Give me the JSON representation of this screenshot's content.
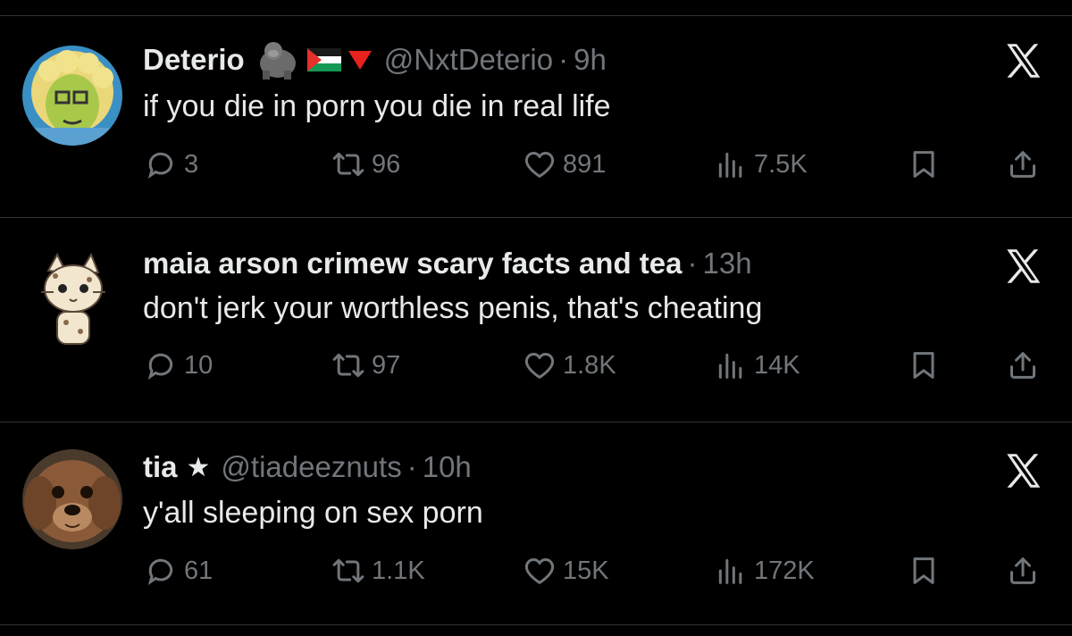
{
  "tweets": [
    {
      "name": "Deterio",
      "badges": [
        "gorilla-emoji",
        "palestine-flag-emoji",
        "red-triangle-emoji"
      ],
      "handle": "@NxtDeterio",
      "separator": "·",
      "time": "9h",
      "text": "if you die in porn you die in real life",
      "replies": "3",
      "retweets": "96",
      "likes": "891",
      "views": "7.5K"
    },
    {
      "name": "maia arson crimew scary facts and tea",
      "handle": "",
      "separator": "·",
      "time": "13h",
      "text": "don't jerk your worthless penis, that's cheating",
      "replies": "10",
      "retweets": "97",
      "likes": "1.8K",
      "views": "14K"
    },
    {
      "name": "tia",
      "star": "★",
      "handle": "@tiadeeznuts",
      "separator": "·",
      "time": "10h",
      "text": "y'all sleeping on sex porn",
      "replies": "61",
      "retweets": "1.1K",
      "likes": "15K",
      "views": "172K"
    }
  ],
  "colors": {
    "background": "#000000",
    "text": "#e7e9ea",
    "muted": "#71767b",
    "divider": "#2f3336"
  },
  "icons": [
    "reply-icon",
    "retweet-icon",
    "like-icon",
    "views-icon",
    "bookmark-icon",
    "share-icon",
    "x-logo-icon"
  ]
}
